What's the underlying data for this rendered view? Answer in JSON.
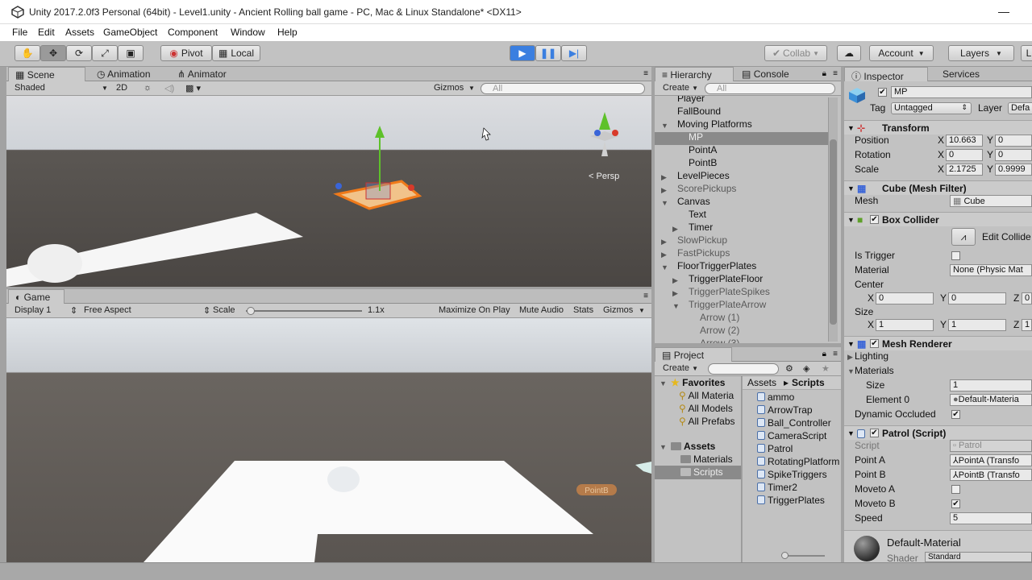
{
  "window": {
    "title": "Unity 2017.2.0f3 Personal (64bit) - Level1.unity - Ancient Rolling ball game - PC, Mac & Linux Standalone* <DX11>",
    "minimize": "—"
  },
  "menu": [
    "File",
    "Edit",
    "Assets",
    "GameObject",
    "Component",
    "Window",
    "Help"
  ],
  "toolbar": {
    "pivot": "Pivot",
    "local": "Local",
    "collab": "Collab",
    "account": "Account",
    "layers": "Layers",
    "layout": "L"
  },
  "scene": {
    "tabs": [
      "Scene",
      "Animation",
      "Animator"
    ],
    "shading": "Shaded",
    "mode2d": "2D",
    "gizmos": "Gizmos",
    "search_placeholder": "All",
    "persp": "Persp"
  },
  "game": {
    "tab": "Game",
    "display": "Display 1",
    "aspect": "Free Aspect",
    "scale_label": "Scale",
    "scale_value": "1.1x",
    "maximize": "Maximize On Play",
    "mute": "Mute Audio",
    "stats": "Stats",
    "gizmos": "Gizmos",
    "pointb_label": "PointB"
  },
  "hierarchy": {
    "tabs": [
      "Hierarchy",
      "Console"
    ],
    "create": "Create",
    "search_placeholder": "All",
    "items": [
      {
        "label": "Player",
        "depth": 1,
        "arrow": "",
        "dim": false,
        "selected": false
      },
      {
        "label": "FallBound",
        "depth": 1,
        "arrow": "",
        "dim": false,
        "selected": false
      },
      {
        "label": "Moving Platforms",
        "depth": 1,
        "arrow": "open",
        "dim": false,
        "selected": false
      },
      {
        "label": "MP",
        "depth": 2,
        "arrow": "",
        "dim": false,
        "selected": true
      },
      {
        "label": "PointA",
        "depth": 2,
        "arrow": "",
        "dim": false,
        "selected": false
      },
      {
        "label": "PointB",
        "depth": 2,
        "arrow": "",
        "dim": false,
        "selected": false
      },
      {
        "label": "LevelPieces",
        "depth": 1,
        "arrow": "closed",
        "dim": false,
        "selected": false
      },
      {
        "label": "ScorePickups",
        "depth": 1,
        "arrow": "closed",
        "dim": true,
        "selected": false
      },
      {
        "label": "Canvas",
        "depth": 1,
        "arrow": "open",
        "dim": false,
        "selected": false
      },
      {
        "label": "Text",
        "depth": 2,
        "arrow": "",
        "dim": false,
        "selected": false
      },
      {
        "label": "Timer",
        "depth": 2,
        "arrow": "closed",
        "dim": false,
        "selected": false
      },
      {
        "label": "SlowPickup",
        "depth": 1,
        "arrow": "closed",
        "dim": true,
        "selected": false
      },
      {
        "label": "FastPickups",
        "depth": 1,
        "arrow": "closed",
        "dim": true,
        "selected": false
      },
      {
        "label": "FloorTriggerPlates",
        "depth": 1,
        "arrow": "open",
        "dim": false,
        "selected": false
      },
      {
        "label": "TriggerPlateFloor",
        "depth": 2,
        "arrow": "closed",
        "dim": false,
        "selected": false
      },
      {
        "label": "TriggerPlateSpikes",
        "depth": 2,
        "arrow": "closed",
        "dim": true,
        "selected": false
      },
      {
        "label": "TriggerPlateArrow",
        "depth": 2,
        "arrow": "open",
        "dim": true,
        "selected": false
      },
      {
        "label": "Arrow (1)",
        "depth": 3,
        "arrow": "",
        "dim": true,
        "selected": false
      },
      {
        "label": "Arrow (2)",
        "depth": 3,
        "arrow": "",
        "dim": true,
        "selected": false
      },
      {
        "label": "Arrow (3)",
        "depth": 3,
        "arrow": "",
        "dim": true,
        "selected": false
      }
    ]
  },
  "project": {
    "tab": "Project",
    "create": "Create",
    "favorites_label": "Favorites",
    "favorites": [
      "All Materia",
      "All Models",
      "All Prefabs"
    ],
    "assets_label": "Assets",
    "folders": [
      "Materials",
      "Scripts"
    ],
    "breadcrumb": [
      "Assets",
      "Scripts"
    ],
    "scripts": [
      "ammo",
      "ArrowTrap",
      "Ball_Controller",
      "CameraScript",
      "Patrol",
      "RotatingPlatform",
      "SpikeTriggers",
      "Timer2",
      "TriggerPlates"
    ]
  },
  "inspector": {
    "tabs": [
      "Inspector",
      "Services"
    ],
    "name": "MP",
    "tag_label": "Tag",
    "tag": "Untagged",
    "layer_label": "Layer",
    "layer": "Defa",
    "transform": {
      "title": "Transform",
      "position_label": "Position",
      "rotation_label": "Rotation",
      "scale_label": "Scale",
      "position": [
        "10.663",
        "0"
      ],
      "rotation": [
        "0",
        "0"
      ],
      "scale": [
        "2.1725",
        "0.9999"
      ]
    },
    "mesh_filter": {
      "title": "Cube (Mesh Filter)",
      "mesh_label": "Mesh",
      "mesh": "Cube"
    },
    "box_collider": {
      "title": "Box Collider",
      "edit": "Edit Collide",
      "is_trigger_label": "Is Trigger",
      "material_label": "Material",
      "material": "None (Physic Mat",
      "center_label": "Center",
      "center": [
        "0",
        "0",
        "0"
      ],
      "size_label": "Size",
      "size": [
        "1",
        "1",
        "1"
      ]
    },
    "mesh_renderer": {
      "title": "Mesh Renderer",
      "lighting": "Lighting",
      "materials": "Materials",
      "size_label": "Size",
      "size": "1",
      "element_label": "Element 0",
      "element": "Default-Materia",
      "dynamic_label": "Dynamic Occluded"
    },
    "patrol": {
      "title": "Patrol (Script)",
      "script_label": "Script",
      "script": "Patrol",
      "pointa_label": "Point A",
      "pointa": "PointA (Transfo",
      "pointb_label": "Point B",
      "pointb": "PointB (Transfo",
      "movetoa_label": "Moveto A",
      "movetob_label": "Moveto B",
      "speed_label": "Speed",
      "speed": "5"
    },
    "material": {
      "name": "Default-Material",
      "shader_label": "Shader",
      "shader": "Standard"
    }
  },
  "axes": {
    "x": "X",
    "y": "Y",
    "z": "Z"
  },
  "colors": {
    "accent": "#3b7fe0",
    "selection": "#8a8a8a",
    "orange": "#f07a1a"
  }
}
